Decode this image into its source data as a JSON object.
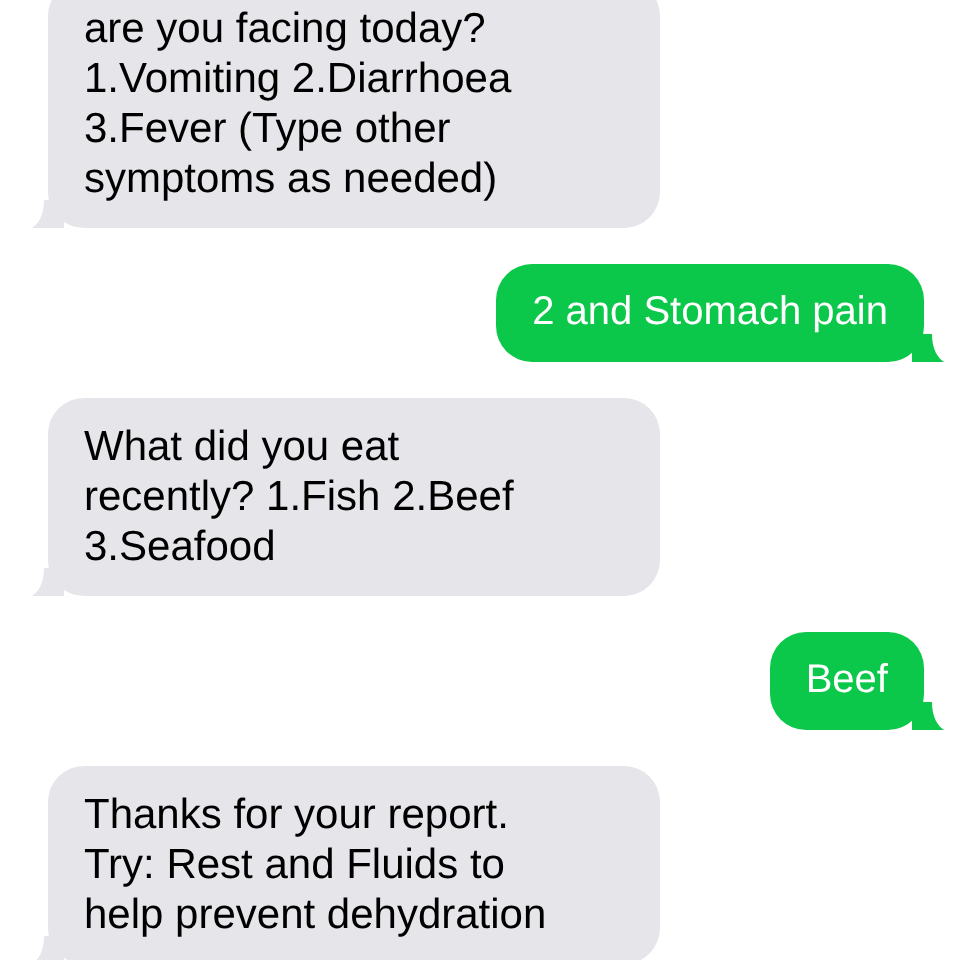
{
  "messages": [
    {
      "kind": "received",
      "lines": [
        "are you facing today?",
        "1.Vomiting 2.Diarrhoea",
        "3.Fever (Type other",
        "symptoms as needed)"
      ]
    },
    {
      "kind": "sent",
      "lines": [
        "2 and Stomach pain"
      ]
    },
    {
      "kind": "received",
      "lines": [
        "What did you eat",
        "recently? 1.Fish 2.Beef",
        "3.Seafood"
      ]
    },
    {
      "kind": "sent",
      "lines": [
        "Beef"
      ]
    },
    {
      "kind": "received",
      "lines": [
        "Thanks for your report.",
        "Try: Rest and Fluids to",
        "help prevent dehydration"
      ]
    }
  ]
}
